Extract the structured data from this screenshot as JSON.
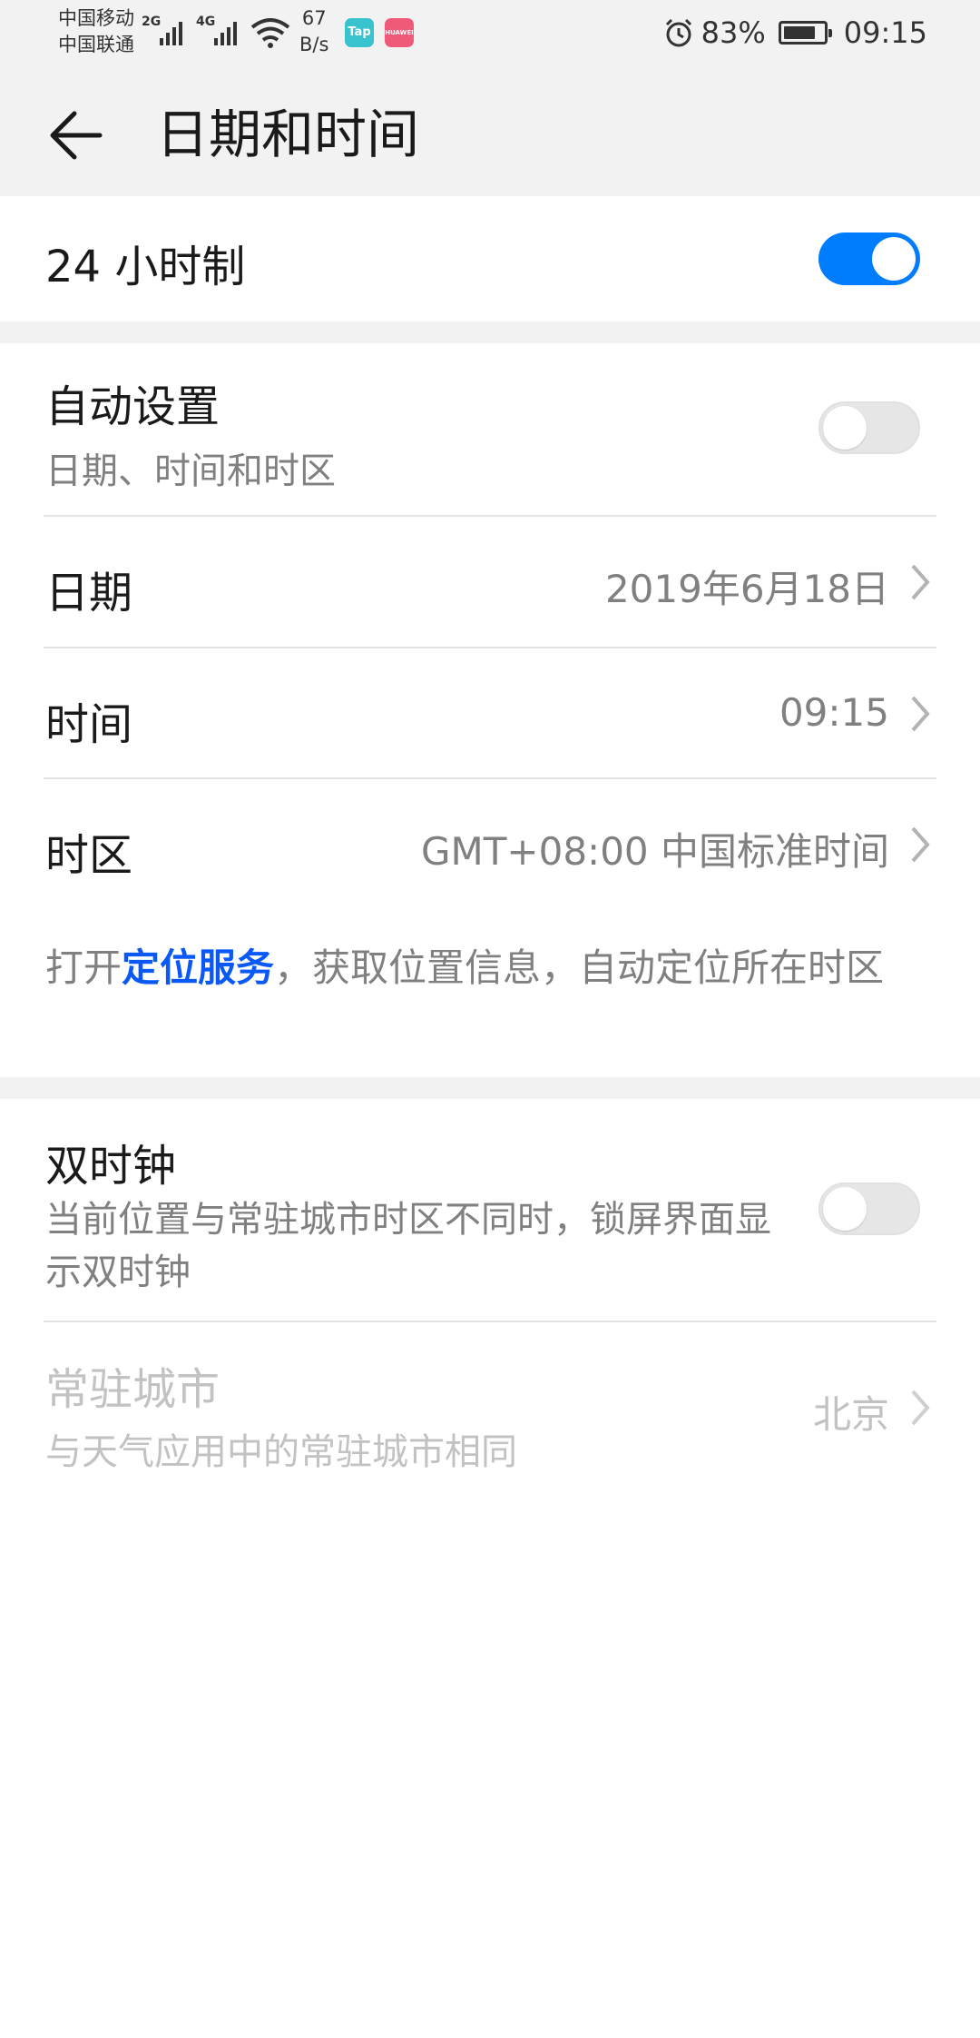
{
  "status_bar": {
    "carrier_1": "中国移动",
    "carrier_2": "中国联通",
    "sim1_type": "2G",
    "sim2_type": "4G",
    "net_speed_value": "67",
    "net_speed_unit": "B/s",
    "app_badge_1": "Tap",
    "app_badge_2": "HUAWEI",
    "battery_percent": "83%",
    "battery_level": 0.83,
    "time": "09:15"
  },
  "header": {
    "title": "日期和时间"
  },
  "settings": {
    "hour24": {
      "label": "24 小时制",
      "enabled": true
    },
    "auto_set": {
      "label": "自动设置",
      "sub": "日期、时间和时区",
      "enabled": false
    },
    "date": {
      "label": "日期",
      "value": "2019年6月18日"
    },
    "time": {
      "label": "时间",
      "value": "09:15"
    },
    "timezone": {
      "label": "时区",
      "value": "GMT+08:00 中国标准时间"
    },
    "location_hint": {
      "prefix": "打开",
      "link": "定位服务",
      "suffix": "，获取位置信息，自动定位所在时区"
    },
    "dual_clock": {
      "label": "双时钟",
      "sub": "当前位置与常驻城市时区不同时，锁屏界面显示双时钟",
      "enabled": false
    },
    "home_city": {
      "label": "常驻城市",
      "sub": "与天气应用中的常驻城市相同",
      "value": "北京"
    }
  },
  "colors": {
    "accent": "#007dff",
    "link": "#0a59f7",
    "secondary_text": "#808080",
    "disabled_text": "#c2c2c2"
  }
}
